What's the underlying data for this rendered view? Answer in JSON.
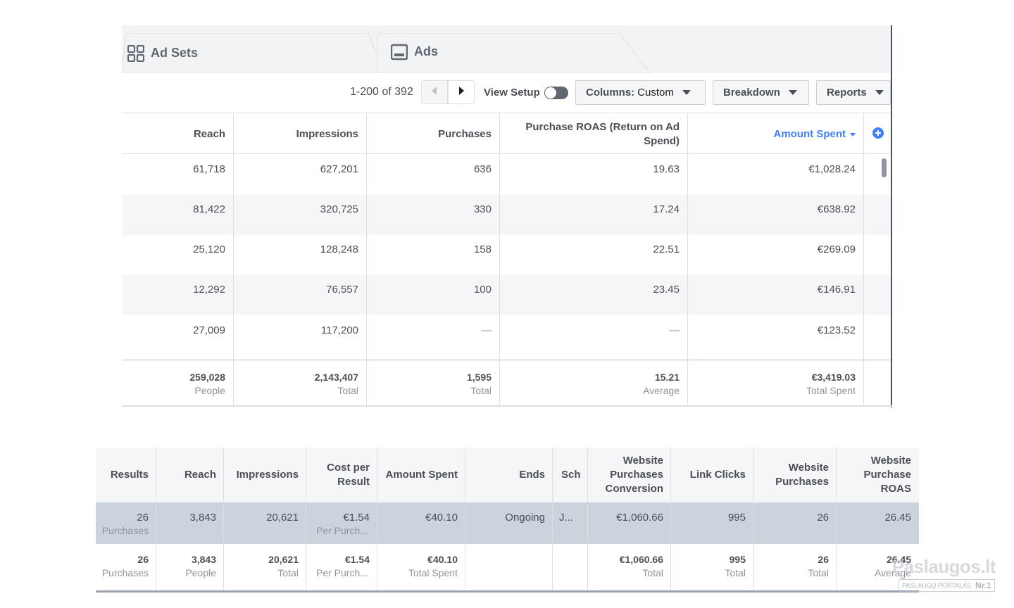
{
  "tabs": [
    {
      "label": "Ad Sets",
      "icon": "grid-icon"
    },
    {
      "label": "Ads",
      "icon": "ad-preview-icon"
    }
  ],
  "toolbar": {
    "pager": "1-200 of 392",
    "view_setup": "View Setup",
    "columns_label": "Columns:",
    "columns_value": "Custom",
    "breakdown": "Breakdown",
    "reports": "Reports"
  },
  "top_table": {
    "headers": [
      "Reach",
      "Impressions",
      "Purchases",
      "Purchase ROAS (Return on Ad Spend)",
      "Amount Spent"
    ],
    "header_roas_lines": [
      "Purchase ROAS (Return on Ad",
      "Spend)"
    ],
    "sorted_column": "Amount Spent",
    "rows": [
      [
        "61,718",
        "627,201",
        "636",
        "19.63",
        "€1,028.24"
      ],
      [
        "81,422",
        "320,725",
        "330",
        "17.24",
        "€638.92"
      ],
      [
        "25,120",
        "128,248",
        "158",
        "22.51",
        "€269.09"
      ],
      [
        "12,292",
        "76,557",
        "100",
        "23.45",
        "€146.91"
      ],
      [
        "27,009",
        "117,200",
        "—",
        "—",
        "€123.52"
      ]
    ],
    "summary": [
      {
        "value": "259,028",
        "label": "People"
      },
      {
        "value": "2,143,407",
        "label": "Total"
      },
      {
        "value": "1,595",
        "label": "Total"
      },
      {
        "value": "15.21",
        "label": "Average"
      },
      {
        "value": "€3,419.03",
        "label": "Total Spent"
      }
    ]
  },
  "bottom_table": {
    "headers": [
      [
        "Results"
      ],
      [
        "Reach"
      ],
      [
        "Impressions"
      ],
      [
        "Cost per",
        "Result"
      ],
      [
        "Amount Spent"
      ],
      [
        "Ends"
      ],
      [
        "Sch"
      ],
      [
        "Website",
        "Purchases",
        "Conversion"
      ],
      [
        "Link Clicks"
      ],
      [
        "Website",
        "Purchases"
      ],
      [
        "Website",
        "Purchase",
        "ROAS"
      ]
    ],
    "row": {
      "values": [
        "26",
        "3,843",
        "20,621",
        "€1.54",
        "€40.10",
        "Ongoing",
        "J...",
        "€1,060.66",
        "995",
        "26",
        "26.45"
      ],
      "subs": [
        "Purchases",
        "",
        "",
        "Per Purch...",
        "",
        "",
        "",
        "",
        "",
        "",
        ""
      ]
    },
    "summary": {
      "values": [
        "26",
        "3,843",
        "20,621",
        "€1.54",
        "€40.10",
        "",
        "",
        "€1,060.66",
        "995",
        "26",
        "26.45"
      ],
      "subs": [
        "Purchases",
        "People",
        "Total",
        "Per Purch...",
        "Total Spent",
        "",
        "",
        "Total",
        "Total",
        "Total",
        "Average"
      ]
    }
  },
  "watermark": {
    "brand": "Paslaugos.lt",
    "tagline": "PASLAUGŲ PORTALAS",
    "badge": "Nr.1"
  },
  "colors": {
    "link_blue": "#4080ff",
    "selected_row": "#cbd3dc",
    "text": "#4b4f56",
    "muted": "#90949c"
  }
}
